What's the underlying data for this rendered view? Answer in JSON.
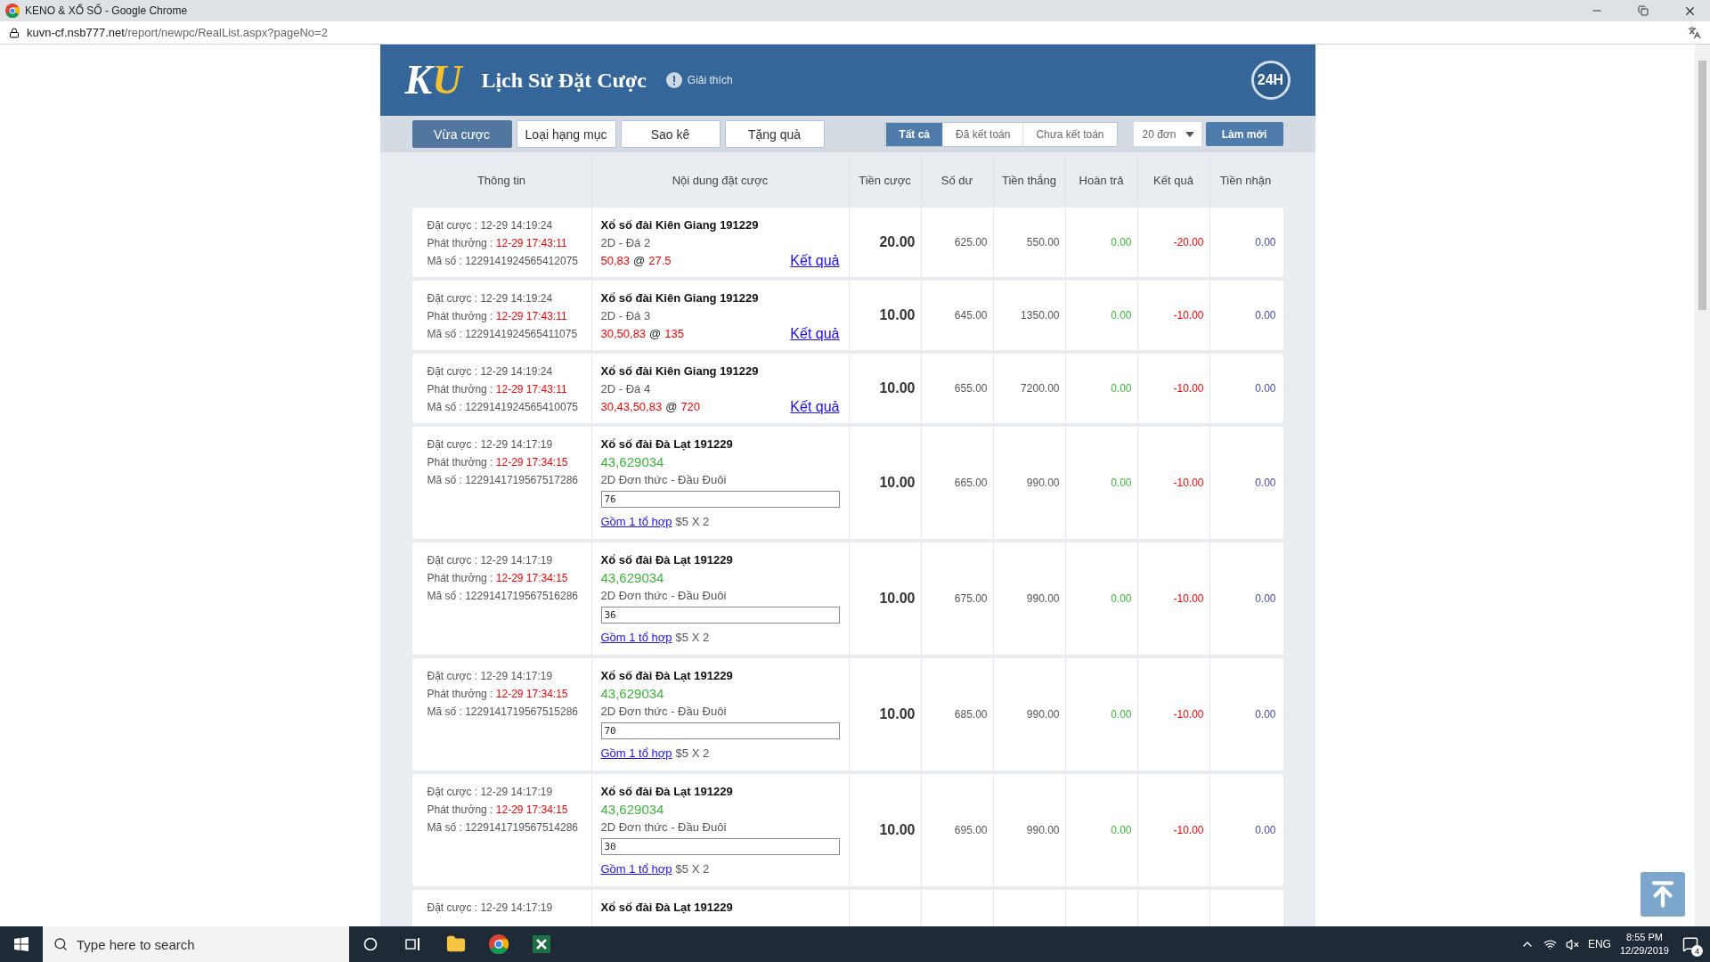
{
  "window": {
    "title": "KENO & XỔ SỐ - Google Chrome"
  },
  "address_bar": {
    "domain": "kuvn-cf.nsb777.net",
    "path": "/report/newpc/RealList.aspx?pageNo=2"
  },
  "header": {
    "logo": [
      {
        "text": "K",
        "color": "#ffffff"
      },
      {
        "text": "U",
        "color": "#f2c12e"
      }
    ],
    "title": "Lịch Sử Đặt Cược",
    "help": "Giải thích",
    "support_badge": "24H"
  },
  "tabs": [
    {
      "label": "Vừa cược",
      "selected": true
    },
    {
      "label": "Loại hạng mục",
      "selected": false
    },
    {
      "label": "Sao kê",
      "selected": false
    },
    {
      "label": "Tặng quà",
      "selected": false
    }
  ],
  "filters": [
    {
      "label": "Tất cả",
      "selected": true
    },
    {
      "label": "Đã kết toán",
      "selected": false
    },
    {
      "label": "Chưa kết toán",
      "selected": false
    }
  ],
  "page_size": {
    "value": "20 đơn"
  },
  "refresh_button": "Làm mới",
  "table": {
    "columns": [
      "Thông tin",
      "Nội dung đặt cược",
      "Tiền cược",
      "Số dư",
      "Tiền thắng",
      "Hoàn trả",
      "Kết quả",
      "Tiền nhận"
    ],
    "rows": [
      {
        "kind": "single",
        "placed": "Đặt cược : 12-29 14:19:24",
        "draw_label": "Phát thưởng : ",
        "draw_time": "12-29 17:43:11",
        "ticket": "Mã số : 1229141924565412075",
        "game": "Xổ số đài Kiên Giang 191229",
        "bet_type": "2D - Đá 2",
        "bet_line": [
          {
            "text": "50,83",
            "highlight": true
          },
          {
            "text": "@",
            "highlight": false
          },
          {
            "text": "27.5",
            "highlight": true
          }
        ],
        "result_link": "Kết quả",
        "stake": "20.00",
        "balance": "625.00",
        "win": "550.00",
        "refund": "0.00",
        "result": "-20.00",
        "payout": "0.00"
      },
      {
        "kind": "single",
        "placed": "Đặt cược : 12-29 14:19:24",
        "draw_label": "Phát thưởng : ",
        "draw_time": "12-29 17:43:11",
        "ticket": "Mã số : 1229141924565411075",
        "game": "Xổ số đài Kiên Giang 191229",
        "bet_type": "2D - Đá 3",
        "bet_line": [
          {
            "text": "30,50,83",
            "highlight": true
          },
          {
            "text": "@",
            "highlight": false
          },
          {
            "text": "135",
            "highlight": true
          }
        ],
        "result_link": "Kết quả",
        "stake": "10.00",
        "balance": "645.00",
        "win": "1350.00",
        "refund": "0.00",
        "result": "-10.00",
        "payout": "0.00"
      },
      {
        "kind": "single",
        "placed": "Đặt cược : 12-29 14:19:24",
        "draw_label": "Phát thưởng : ",
        "draw_time": "12-29 17:43:11",
        "ticket": "Mã số : 1229141924565410075",
        "game": "Xổ số đài Kiên Giang 191229",
        "bet_type": "2D - Đá 4",
        "bet_line": [
          {
            "text": "30,43,50,83",
            "highlight": true
          },
          {
            "text": "@",
            "highlight": false
          },
          {
            "text": "720",
            "highlight": true
          }
        ],
        "result_link": "Kết quả",
        "stake": "10.00",
        "balance": "655.00",
        "win": "7200.00",
        "refund": "0.00",
        "result": "-10.00",
        "payout": "0.00"
      },
      {
        "kind": "combo",
        "placed": "Đặt cược : 12-29 14:17:19",
        "draw_label": "Phát thưởng : ",
        "draw_time": "12-29 17:34:15",
        "ticket": "Mã số : 1229141719567517286",
        "game": "Xổ số đài Đà Lạt 191229",
        "draw_numbers": "43,629034",
        "bet_type": "2D Đơn thức - Đầu Đuôi",
        "picked": "76",
        "combo_link": "Gồm 1 tổ hợp",
        "combo_detail": "$5 X 2",
        "stake": "10.00",
        "balance": "665.00",
        "win": "990.00",
        "refund": "0.00",
        "result": "-10.00",
        "payout": "0.00"
      },
      {
        "kind": "combo",
        "placed": "Đặt cược : 12-29 14:17:19",
        "draw_label": "Phát thưởng : ",
        "draw_time": "12-29 17:34:15",
        "ticket": "Mã số : 1229141719567516286",
        "game": "Xổ số đài Đà Lạt 191229",
        "draw_numbers": "43,629034",
        "bet_type": "2D Đơn thức - Đầu Đuôi",
        "picked": "36",
        "combo_link": "Gồm 1 tổ hợp",
        "combo_detail": "$5 X 2",
        "stake": "10.00",
        "balance": "675.00",
        "win": "990.00",
        "refund": "0.00",
        "result": "-10.00",
        "payout": "0.00"
      },
      {
        "kind": "combo",
        "placed": "Đặt cược : 12-29 14:17:19",
        "draw_label": "Phát thưởng : ",
        "draw_time": "12-29 17:34:15",
        "ticket": "Mã số : 1229141719567515286",
        "game": "Xổ số đài Đà Lạt 191229",
        "draw_numbers": "43,629034",
        "bet_type": "2D Đơn thức - Đầu Đuôi",
        "picked": "70",
        "combo_link": "Gồm 1 tổ hợp",
        "combo_detail": "$5 X 2",
        "stake": "10.00",
        "balance": "685.00",
        "win": "990.00",
        "refund": "0.00",
        "result": "-10.00",
        "payout": "0.00"
      },
      {
        "kind": "combo",
        "placed": "Đặt cược : 12-29 14:17:19",
        "draw_label": "Phát thưởng : ",
        "draw_time": "12-29 17:34:15",
        "ticket": "Mã số : 1229141719567514286",
        "game": "Xổ số đài Đà Lạt 191229",
        "draw_numbers": "43,629034",
        "bet_type": "2D Đơn thức - Đầu Đuôi",
        "picked": "30",
        "combo_link": "Gồm 1 tổ hợp",
        "combo_detail": "$5 X 2",
        "stake": "10.00",
        "balance": "695.00",
        "win": "990.00",
        "refund": "0.00",
        "result": "-10.00",
        "payout": "0.00"
      },
      {
        "kind": "partial",
        "placed": "Đặt cược : 12-29 14:17:19",
        "game": "Xổ số đài Đà Lạt 191229"
      }
    ]
  },
  "taskbar": {
    "search_placeholder": "Type here to search",
    "language": "ENG",
    "time": "8:55 PM",
    "date": "12/29/2019",
    "notifications": "4"
  }
}
